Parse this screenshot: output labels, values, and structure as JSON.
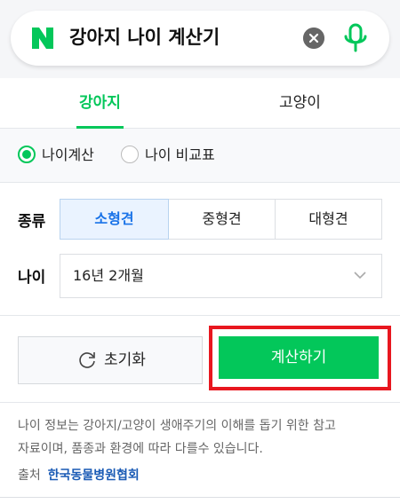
{
  "search": {
    "query": "강아지 나이 계산기"
  },
  "tabs": [
    {
      "label": "강아지",
      "active": true
    },
    {
      "label": "고양이",
      "active": false
    }
  ],
  "modes": [
    {
      "label": "나이계산",
      "selected": true
    },
    {
      "label": "나이 비교표",
      "selected": false
    }
  ],
  "breed": {
    "label": "종류",
    "options": [
      "소형견",
      "중형견",
      "대형견"
    ],
    "selected": "소형견"
  },
  "age": {
    "label": "나이",
    "value": "16년 2개월"
  },
  "buttons": {
    "reset": "초기화",
    "calculate": "계산하기"
  },
  "info": {
    "line1": "나이 정보는 강아지/고양이 생애주기의 이해를 돕기 위한 참고",
    "line2": "자료이며, 품종과 환경에 따라 다를수 있습니다.",
    "source_label": "출처",
    "source_link": "한국동물병원협회"
  },
  "colors": {
    "accent": "#03c75a",
    "link": "#1a5bb5",
    "highlight": "#e8171f"
  },
  "icons": [
    "naver-logo-icon",
    "clear-icon",
    "mic-icon",
    "chevron-down-icon",
    "refresh-icon"
  ]
}
